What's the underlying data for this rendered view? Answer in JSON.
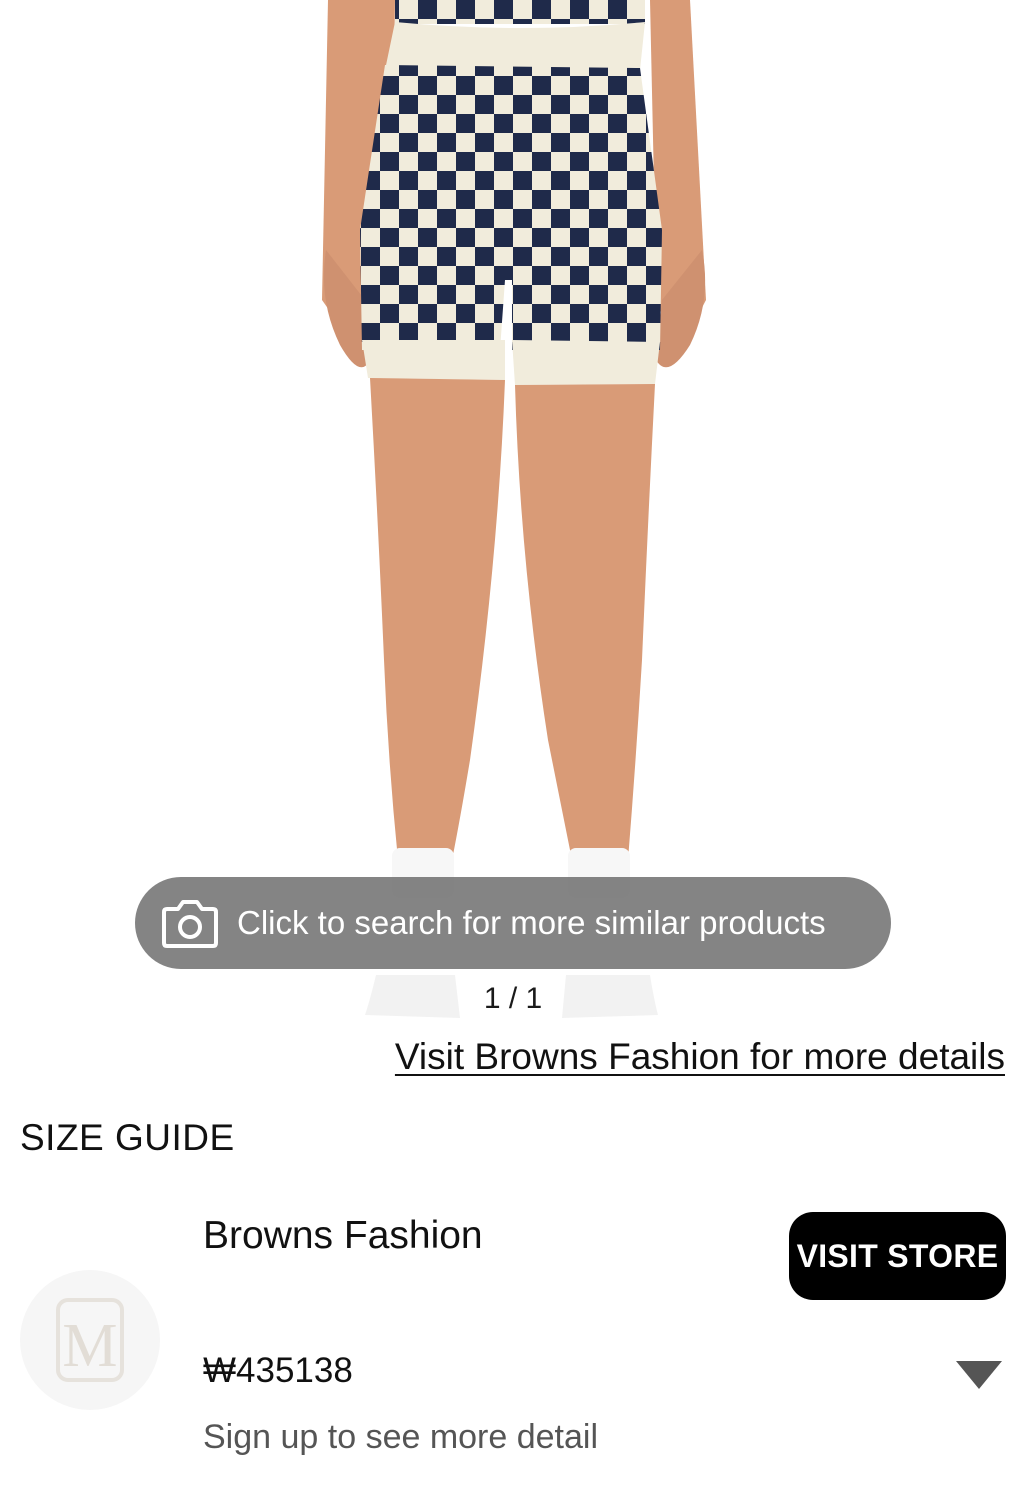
{
  "product_image": {
    "alt": "Checkered crochet knit shorts",
    "colors": {
      "checker_dark": "#1f2a4a",
      "checker_light": "#f1ecdc",
      "skin": "#d99b77",
      "socks": "#f7f7f7"
    }
  },
  "image_search": {
    "label": "Click to search for more similar products",
    "icon": "camera-icon"
  },
  "gallery": {
    "counter": "1 / 1"
  },
  "visit_link": "Visit Browns Fashion for more details",
  "size_guide": "SIZE GUIDE",
  "store": {
    "logo_letter": "M",
    "name": "Browns Fashion",
    "visit_button": "VISIT STORE"
  },
  "price": "₩435138",
  "signup_text": "Sign up to see more detail",
  "expand_icon": "triangle-down-icon",
  "colors": {
    "pill_bg": "rgba(105,105,105,0.82)",
    "button_bg": "#000000",
    "muted_text": "#555555"
  }
}
